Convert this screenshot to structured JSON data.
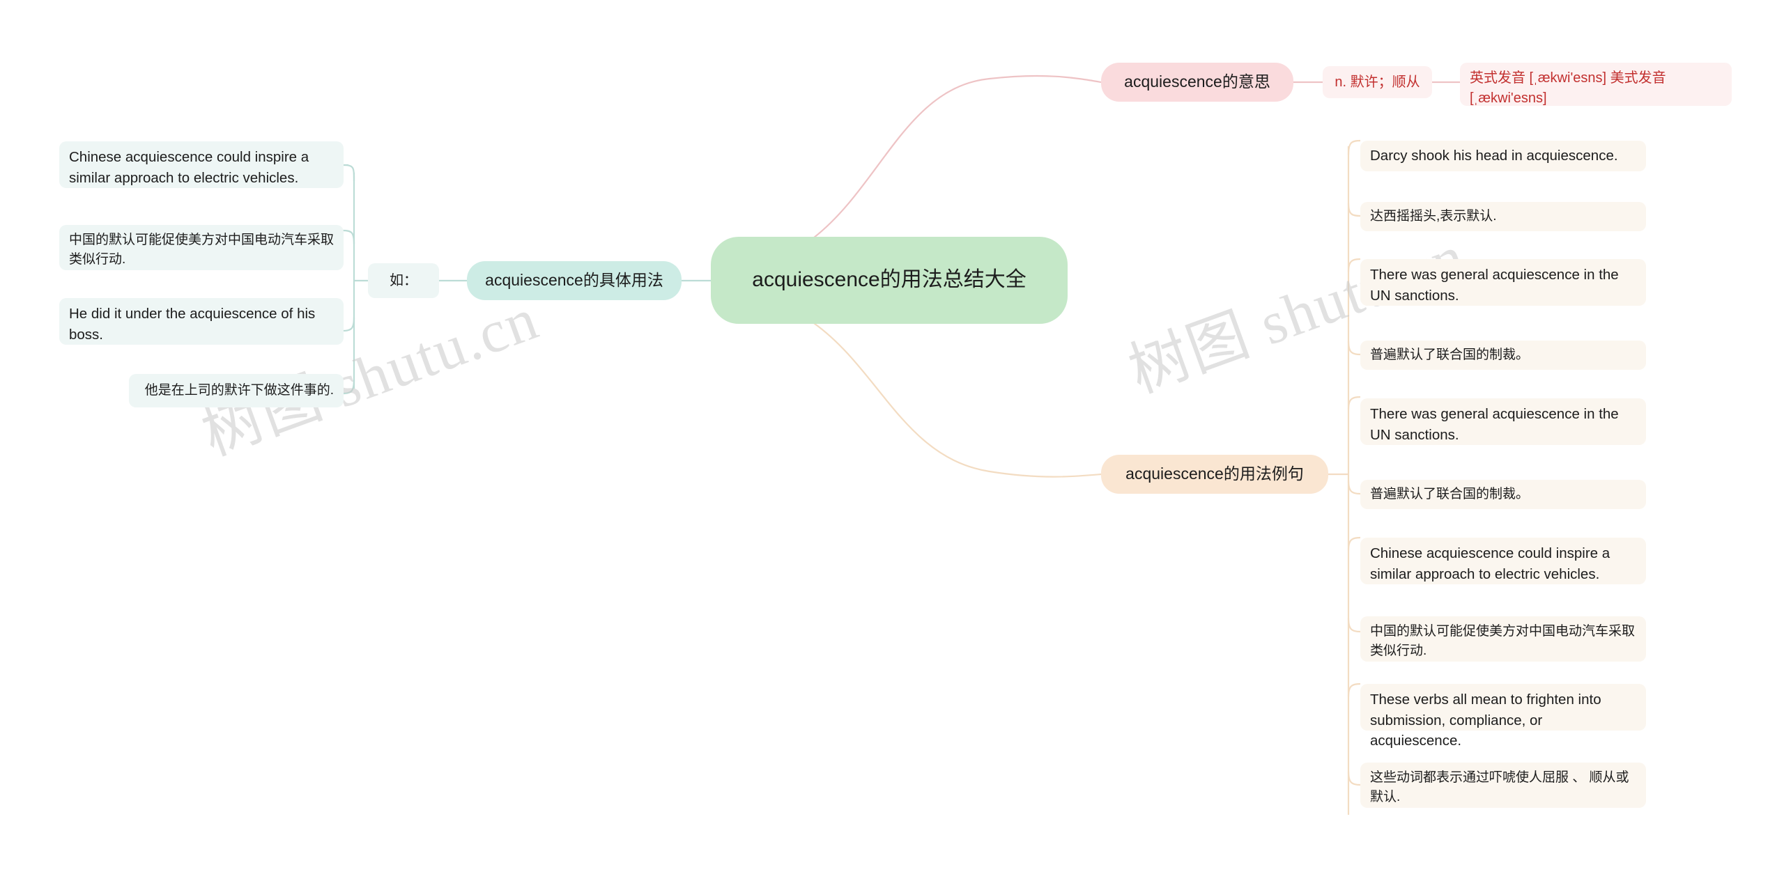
{
  "meta": {
    "watermark_text": "树图 shutu.cn",
    "colors": {
      "root_fill": "#c5e8c8",
      "teal_fill": "#cdece5",
      "pink_fill": "#fadbdd",
      "orange_fill": "#fae6d2",
      "teal_card": "#eef6f5",
      "pink_card": "#fdf1f1",
      "cream_card": "#fbf6ef",
      "teal_edge": "#bcdcd6",
      "pink_edge": "#eec3c5",
      "orange_edge": "#f3dcc2",
      "red_text": "#c2302f",
      "body_text": "#1c1c1c"
    }
  },
  "root": {
    "label": "acquiescence的用法总结大全"
  },
  "branches": {
    "usage": {
      "label": "acquiescence的具体用法",
      "connector_label": "如：",
      "items": [
        {
          "text": "Chinese acquiescence could inspire a similar approach to electric vehicles.",
          "lang": "en"
        },
        {
          "text": "中国的默认可能促使美方对中国电动汽车采取类似行动.",
          "lang": "cn"
        },
        {
          "text": "He did it under the acquiescence of his boss.",
          "lang": "en"
        },
        {
          "text": "他是在上司的默许下做这件事的.",
          "lang": "cn"
        }
      ]
    },
    "meaning": {
      "label": "acquiescence的意思",
      "definition": "n. 默许；顺从",
      "pronunciation": "英式发音 [ˌækwi'esns] 美式发音 [ˌækwi'esns]"
    },
    "examples": {
      "label": "acquiescence的用法例句",
      "items": [
        {
          "text": "Darcy shook his head in acquiescence.",
          "lang": "en"
        },
        {
          "text": "达西摇摇头,表示默认.",
          "lang": "cn"
        },
        {
          "text": "There was general acquiescence in the UN sanctions.",
          "lang": "en"
        },
        {
          "text": "普遍默认了联合国的制裁。",
          "lang": "cn"
        },
        {
          "text": "There was general acquiescence in the UN sanctions.",
          "lang": "en"
        },
        {
          "text": "普遍默认了联合国的制裁。",
          "lang": "cn"
        },
        {
          "text": "Chinese acquiescence could inspire a similar approach to electric vehicles.",
          "lang": "en"
        },
        {
          "text": "中国的默认可能促使美方对中国电动汽车采取类似行动.",
          "lang": "cn"
        },
        {
          "text": "These verbs all mean to frighten into submission, compliance, or acquiescence.",
          "lang": "en"
        },
        {
          "text": "这些动词都表示通过吓唬使人屈服 、 顺从或默认.",
          "lang": "cn"
        }
      ]
    }
  }
}
